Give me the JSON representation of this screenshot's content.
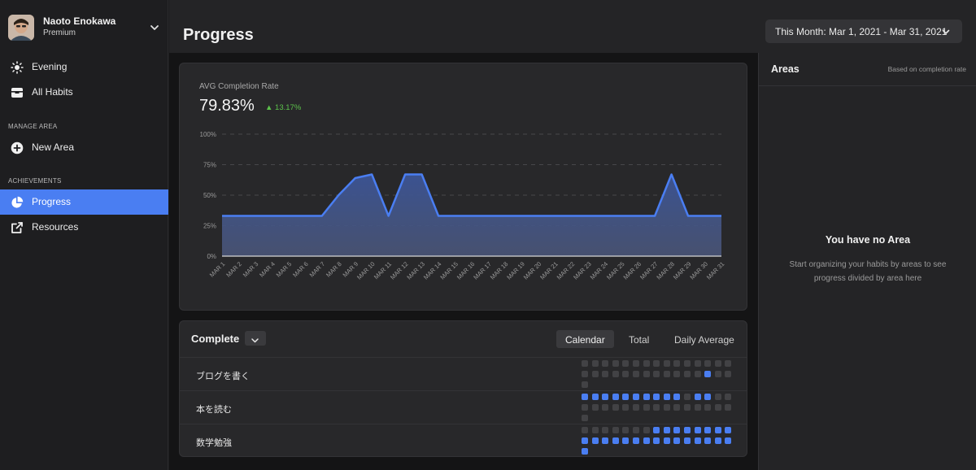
{
  "user": {
    "name": "Naoto Enokawa",
    "plan": "Premium"
  },
  "sidebar": {
    "items": [
      {
        "label": "Evening",
        "icon": "sun-icon"
      },
      {
        "label": "All Habits",
        "icon": "tray-icon"
      }
    ],
    "manage_area_title": "MANAGE AREA",
    "new_area_label": "New Area",
    "achievements_title": "ACHIEVEMENTS",
    "progress_label": "Progress",
    "resources_label": "Resources"
  },
  "header": {
    "title": "Progress",
    "date_range": "This Month: Mar 1, 2021 - Mar 31, 2021"
  },
  "stats": {
    "avg_label": "AVG Completion Rate",
    "avg_value": "79.83%",
    "delta": "13.17%"
  },
  "colors": {
    "accent": "#4a7ef2",
    "positive": "#5cc24b"
  },
  "chart_data": {
    "type": "area",
    "y_ticks": [
      "100%",
      "75%",
      "50%",
      "25%",
      "0%"
    ],
    "ylim": [
      0,
      100
    ],
    "categories": [
      "MAR 1",
      "MAR 2",
      "MAR 3",
      "MAR 4",
      "MAR 5",
      "MAR 6",
      "MAR 7",
      "MAR 8",
      "MAR 9",
      "MAR 10",
      "MAR 11",
      "MAR 12",
      "MAR 13",
      "MAR 14",
      "MAR 15",
      "MAR 16",
      "MAR 17",
      "MAR 18",
      "MAR 19",
      "MAR 20",
      "MAR 21",
      "MAR 22",
      "MAR 23",
      "MAR 24",
      "MAR 25",
      "MAR 26",
      "MAR 27",
      "MAR 28",
      "MAR 29",
      "MAR 30",
      "MAR 31"
    ],
    "values": [
      33,
      33,
      33,
      33,
      33,
      33,
      33,
      50,
      64,
      67,
      33,
      67,
      67,
      33,
      33,
      33,
      33,
      33,
      33,
      33,
      33,
      33,
      33,
      33,
      33,
      33,
      33,
      67,
      33,
      33,
      33
    ],
    "grid": true
  },
  "complete": {
    "title": "Complete",
    "tabs": [
      "Calendar",
      "Total",
      "Daily Average"
    ],
    "active_tab": 0,
    "habits": [
      {
        "name": "ブログを書く",
        "days": [
          0,
          0,
          0,
          0,
          0,
          0,
          0,
          0,
          0,
          0,
          0,
          0,
          0,
          0,
          0,
          0,
          0,
          0,
          0,
          0,
          0,
          0,
          0,
          0,
          0,
          0,
          0,
          1,
          0,
          0,
          0
        ]
      },
      {
        "name": "本を読む",
        "days": [
          1,
          1,
          1,
          1,
          1,
          1,
          1,
          1,
          1,
          1,
          0,
          1,
          1,
          0,
          0,
          0,
          0,
          0,
          0,
          0,
          0,
          0,
          0,
          0,
          0,
          0,
          0,
          0,
          0,
          0,
          0
        ]
      },
      {
        "name": "数学勉強",
        "days": [
          0,
          0,
          0,
          0,
          0,
          0,
          0,
          1,
          1,
          1,
          1,
          1,
          1,
          1,
          1,
          1,
          1,
          1,
          1,
          1,
          1,
          1,
          1,
          1,
          1,
          1,
          1,
          1,
          1,
          1,
          1
        ]
      }
    ]
  },
  "areas": {
    "title": "Areas",
    "note": "Based on completion rate",
    "empty_title": "You have no Area",
    "empty_desc": "Start organizing your habits by areas to see progress divided by area here"
  }
}
